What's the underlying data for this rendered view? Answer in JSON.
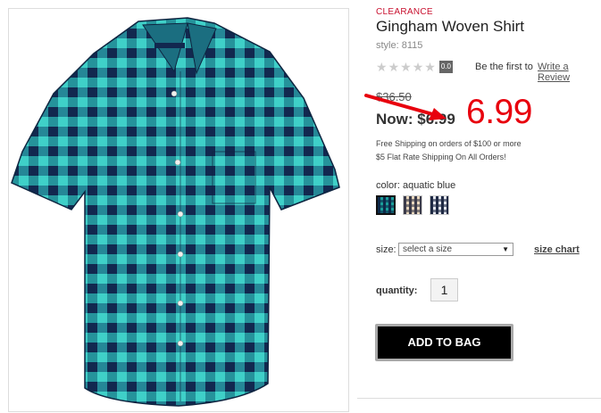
{
  "product": {
    "badge": "CLEARANCE",
    "title": "Gingham Woven Shirt",
    "style": "style: 8115",
    "rating_value": "0.0",
    "rating_stars": 0,
    "review_prompt": "Be the first to",
    "review_link": "Write a Review",
    "original_price": "$36.50",
    "now_price": "Now: $6.99",
    "annotation_price": "6.99",
    "shipping_line1": "Free Shipping on orders of $100 or more",
    "shipping_line2": "$5 Flat Rate Shipping On All Orders!"
  },
  "color": {
    "label": "color: aquatic blue",
    "swatches": [
      {
        "name": "aquatic blue",
        "bg": "#1a9e9a",
        "check": "#0d2a4a",
        "selected": true
      },
      {
        "name": "tan",
        "bg": "#e8d6bc",
        "check": "#3b3b4a",
        "selected": false
      },
      {
        "name": "navy",
        "bg": "#e6e9f0",
        "check": "#1f2a44",
        "selected": false
      }
    ]
  },
  "size": {
    "label": "size:",
    "selected": "select a size",
    "chart_link": "size chart"
  },
  "quantity": {
    "label": "quantity:",
    "value": "1"
  },
  "cart": {
    "button_label": "ADD TO BAG"
  },
  "colors": {
    "accent_red": "#e8000d",
    "clearance_red": "#c8102e",
    "shirt_teal": "#20b5b0",
    "shirt_navy": "#14305a"
  }
}
